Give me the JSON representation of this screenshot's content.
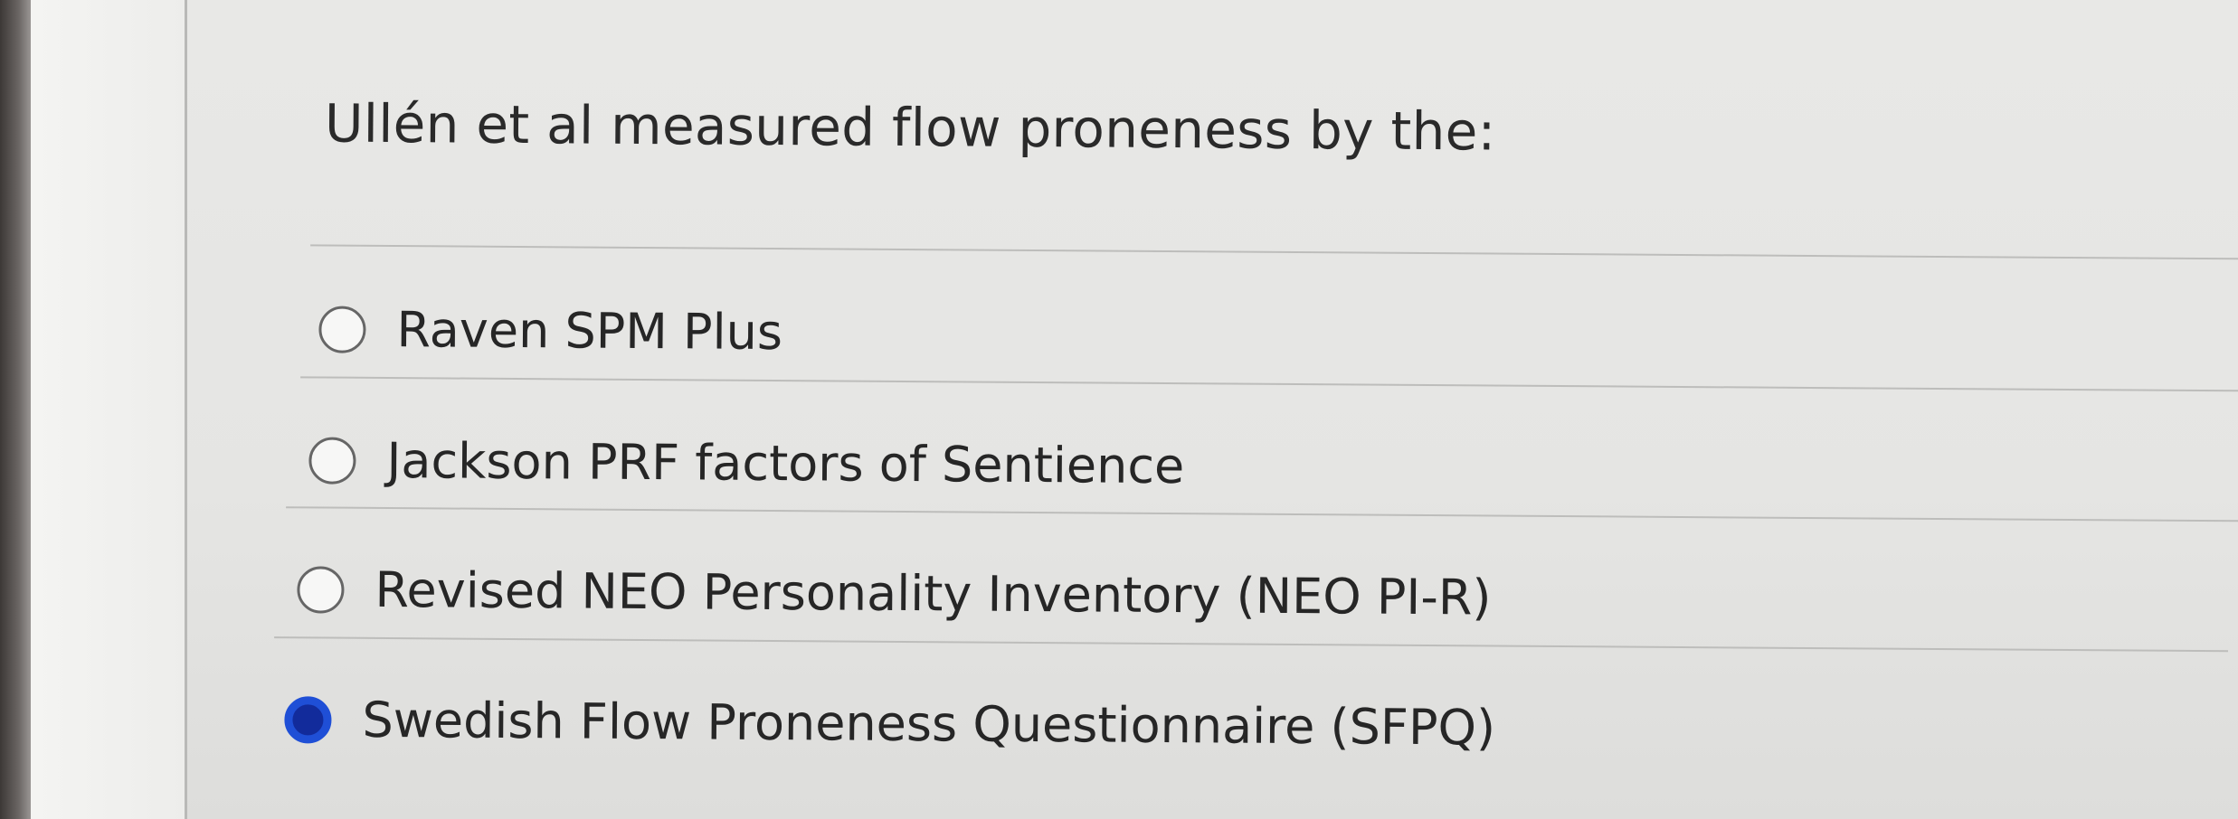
{
  "question": {
    "text": "Ullén et al measured flow proneness by the:"
  },
  "options": [
    {
      "label": "Raven SPM Plus",
      "selected": false
    },
    {
      "label": "Jackson PRF factors of Sentience",
      "selected": false
    },
    {
      "label": "Revised NEO Personality Inventory (NEO PI-R)",
      "selected": false
    },
    {
      "label": "Swedish Flow Proneness Questionnaire (SFPQ)",
      "selected": true
    }
  ],
  "colors": {
    "radio_selected": "#1f4fd6",
    "text": "#262626",
    "divider": "#bdbdbb"
  }
}
